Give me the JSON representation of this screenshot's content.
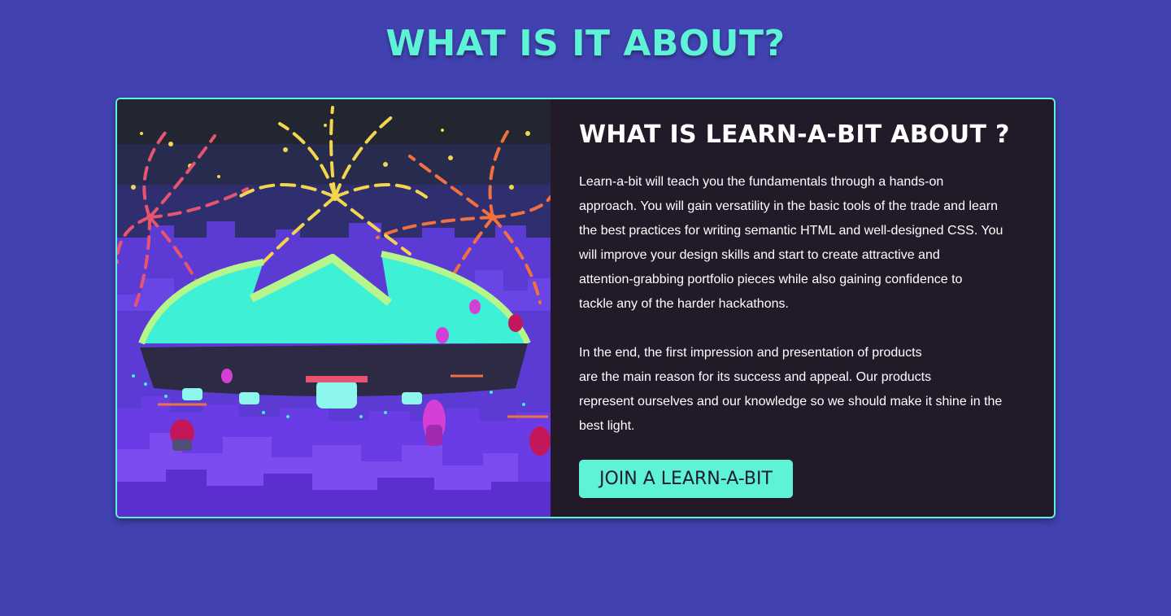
{
  "section": {
    "title": "WHAT IS IT ABOUT?"
  },
  "card": {
    "image_alt": "Illustration of a glowing dome stadium under fireworks with flying robot drones",
    "title": "WHAT IS LEARN-A-BIT ABOUT ?",
    "paragraphs": [
      "Learn-a-bit will teach you the fundamentals through a hands-on\napproach. You will gain versatility in the basic tools of the trade and learn\nthe best practices for writing semantic HTML and well-designed CSS. You\nwill improve your design skills and start to create attractive and\nattention-grabbing portfolio pieces while also gaining confidence to\ntackle any of the harder hackathons.",
      "In the end, the first impression and presentation of products\nare the main reason for its success and appeal. Our products\nrepresent ourselves and our knowledge so we should make it shine in the\nbest light."
    ],
    "cta_label": "JOIN A LEARN-A-BIT"
  },
  "colors": {
    "background": "#4142b0",
    "accent": "#5ef2d6",
    "card_background": "#221a28",
    "text": "#ffffff"
  }
}
